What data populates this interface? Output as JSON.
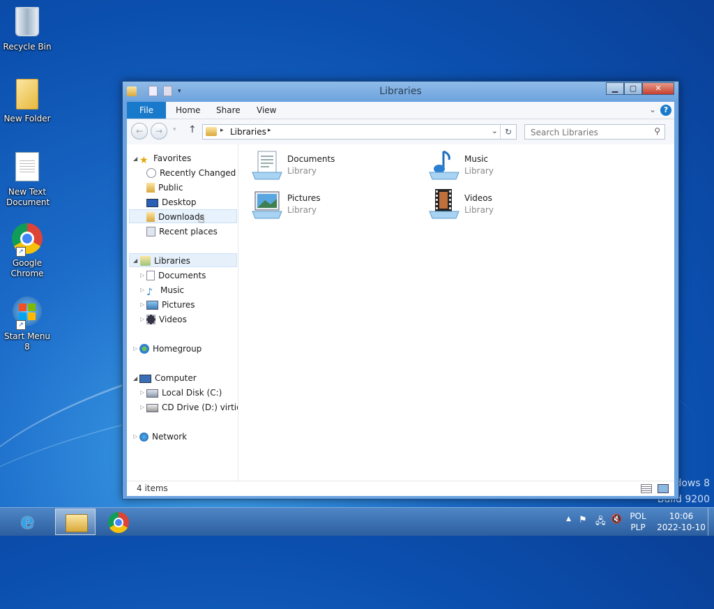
{
  "desktop": {
    "icons": [
      {
        "label": "Recycle Bin"
      },
      {
        "label": "New Folder"
      },
      {
        "label": "New Text Document"
      },
      {
        "label": "Google Chrome"
      },
      {
        "label": "Start Menu 8"
      }
    ],
    "watermark_line1": "dows 8",
    "watermark_line2": "Build 9200"
  },
  "window": {
    "title": "Libraries",
    "ribbon_tabs": [
      "File",
      "Home",
      "Share",
      "View"
    ],
    "address": {
      "crumb": "Libraries"
    },
    "search": {
      "placeholder": "Search Libraries"
    },
    "nav": {
      "favorites": {
        "label": "Favorites",
        "items": [
          "Recently Changed",
          "Public",
          "Desktop",
          "Downloads",
          "Recent places"
        ]
      },
      "libraries": {
        "label": "Libraries",
        "items": [
          "Documents",
          "Music",
          "Pictures",
          "Videos"
        ]
      },
      "homegroup": {
        "label": "Homegroup"
      },
      "computer": {
        "label": "Computer",
        "items": [
          "Local Disk (C:)",
          "CD Drive (D:) virtio-win"
        ]
      },
      "network": {
        "label": "Network"
      }
    },
    "libraries": [
      {
        "name": "Documents",
        "type": "Library"
      },
      {
        "name": "Music",
        "type": "Library"
      },
      {
        "name": "Pictures",
        "type": "Library"
      },
      {
        "name": "Videos",
        "type": "Library"
      }
    ],
    "status": {
      "count": "4 items"
    }
  },
  "taskbar": {
    "language_top": "POL",
    "language_bottom": "PLP",
    "time": "10:06",
    "date": "2022-10-10"
  },
  "icons": [
    "recycle-bin-icon",
    "folder-icon",
    "text-document-icon",
    "chrome-icon",
    "windows-logo-icon",
    "star-icon",
    "library-icon",
    "homegroup-icon",
    "computer-icon",
    "network-icon",
    "ie-icon",
    "explorer-icon",
    "flag-icon",
    "network-tray-icon",
    "volume-muted-icon"
  ]
}
